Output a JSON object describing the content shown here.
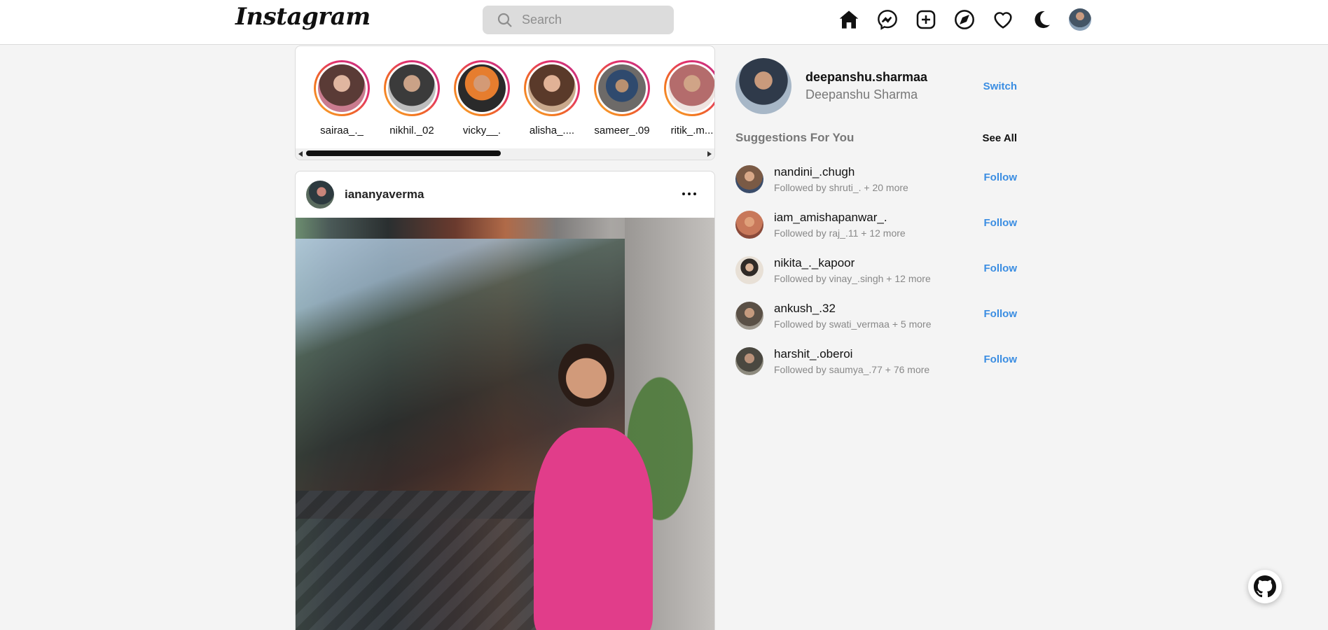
{
  "nav": {
    "logo": "Instagram",
    "search_placeholder": "Search",
    "icons": [
      "home-icon",
      "messenger-icon",
      "create-icon",
      "explore-icon",
      "heart-icon",
      "moon-icon"
    ]
  },
  "stories": [
    {
      "name": "sairaa_._",
      "color": "#e0b6a0"
    },
    {
      "name": "nikhil._02",
      "color": "#8e8e8e"
    },
    {
      "name": "vicky__.",
      "color": "#6b5443"
    },
    {
      "name": "alisha_....",
      "color": "#c9a98c"
    },
    {
      "name": "sameer_.09",
      "color": "#6d6a68"
    },
    {
      "name": "ritik_.m...",
      "color": "#b46c6c"
    }
  ],
  "post": {
    "username": "iananyaverma"
  },
  "sidebar": {
    "username": "deepanshu.sharmaa",
    "fullname": "Deepanshu Sharma",
    "switch_label": "Switch",
    "suggestions_title": "Suggestions For You",
    "see_all_label": "See All",
    "follow_label": "Follow",
    "suggestions": [
      {
        "username": "nandini_.chugh",
        "followed_by": "Followed by shruti_. + 20 more",
        "color": "#7a5a45"
      },
      {
        "username": "iam_amishapanwar_.",
        "followed_by": "Followed by raj_.11 + 12 more",
        "color": "#c8785a"
      },
      {
        "username": "nikita_._kapoor",
        "followed_by": "Followed by vinay_.singh + 12 more",
        "color": "#e8e0d6"
      },
      {
        "username": "ankush_.32",
        "followed_by": "Followed by swati_vermaa + 5 more",
        "color": "#5a5046"
      },
      {
        "username": "harshit_.oberoi",
        "followed_by": "Followed by saumya_.77 + 76 more",
        "color": "#4a4840"
      }
    ]
  },
  "accent_color": "#3a8de2"
}
